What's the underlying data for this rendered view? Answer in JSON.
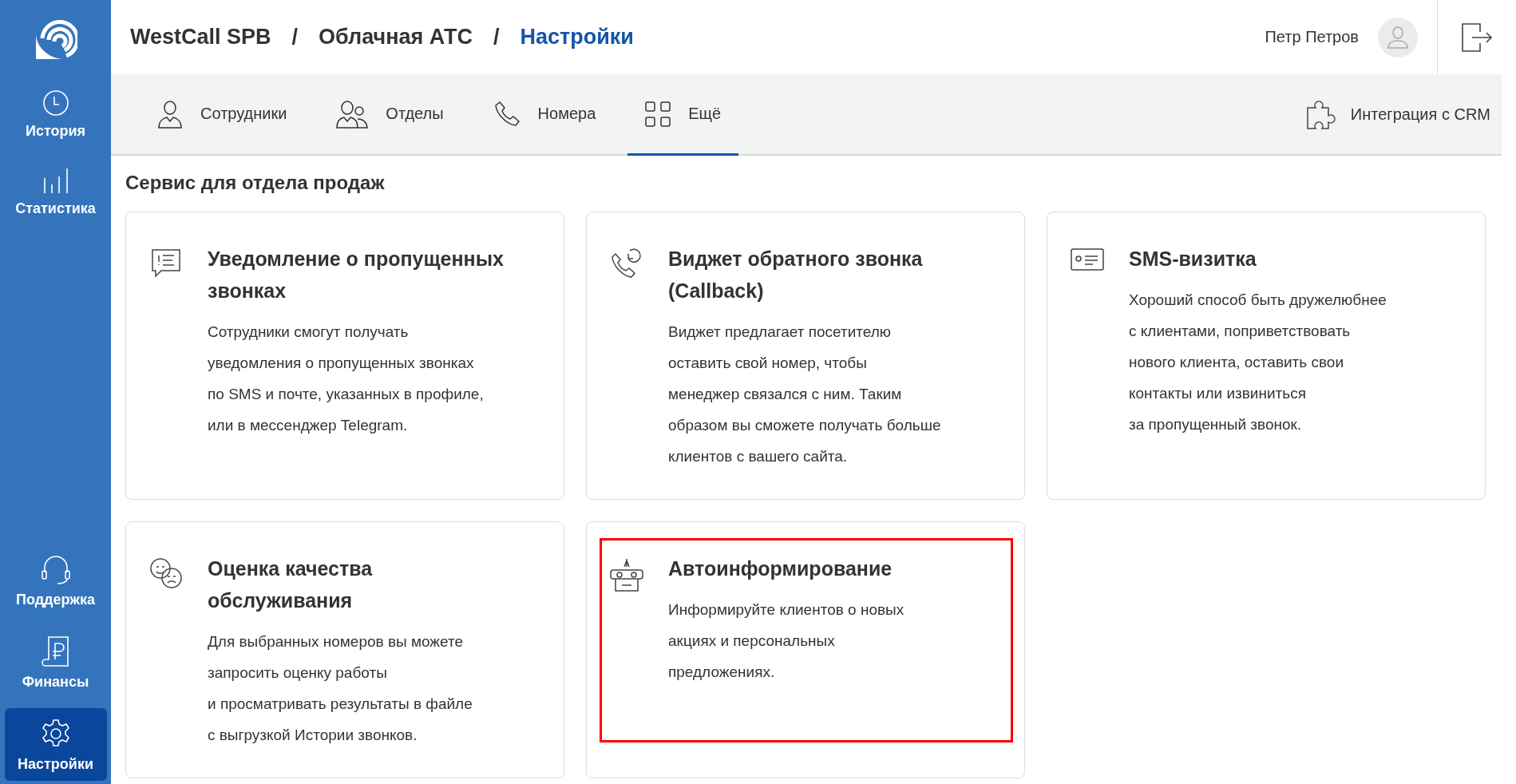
{
  "sidebar": {
    "top_items": [
      {
        "label": "История",
        "kind": "clock",
        "selected": false
      },
      {
        "label": "Статистика",
        "kind": "bars",
        "selected": false
      }
    ],
    "bottom_items": [
      {
        "label": "Поддержка",
        "kind": "headset",
        "selected": false
      },
      {
        "label": "Финансы",
        "kind": "ruble",
        "selected": false
      },
      {
        "label": "Настройки",
        "kind": "gear",
        "selected": true
      }
    ]
  },
  "breadcrumb": [
    {
      "kind": "item",
      "text": "WestCall SPB",
      "current": false
    },
    {
      "kind": "separator",
      "text": "/"
    },
    {
      "kind": "item",
      "text": "Облачная АТС",
      "current": false
    },
    {
      "kind": "separator",
      "text": "/"
    },
    {
      "kind": "item",
      "text": "Настройки",
      "current": true
    }
  ],
  "user": {
    "name": "Петр Петров"
  },
  "tabs": [
    {
      "label": "Сотрудники",
      "kind": "person",
      "selected": false
    },
    {
      "label": "Отделы",
      "kind": "people",
      "selected": false
    },
    {
      "label": "Номера",
      "kind": "phone",
      "selected": false
    },
    {
      "label": "Ещё",
      "kind": "grid",
      "selected": true
    }
  ],
  "crm_link": {
    "label": "Интеграция с CRM"
  },
  "section_title": "Сервис для отдела продаж",
  "cards": [
    {
      "kind": "message",
      "title_lines": [
        "Уведомление о пропущенных",
        "звонках"
      ],
      "description_lines": [
        "Сотрудники смогут получать",
        "уведомления о пропущенных звонках",
        "по SMS и почте, указанных в профиле,",
        "или в мессенджер Telegram."
      ],
      "highlighted": false
    },
    {
      "kind": "callback",
      "title_lines": [
        "Виджет обратного звонка",
        "(Callback)"
      ],
      "description_lines": [
        "Виджет предлагает посетителю",
        "оставить свой номер, чтобы",
        "менеджер связался с ним. Таким",
        "образом вы сможете получать больше",
        "клиентов с вашего сайта."
      ],
      "highlighted": false
    },
    {
      "kind": "card",
      "title_lines": [
        "SMS-визитка"
      ],
      "description_lines": [
        "Хороший способ быть дружелюбнее",
        "с клиентами, поприветствовать",
        "нового клиента, оставить свои",
        "контакты или извиниться",
        "за пропущенный звонок."
      ],
      "highlighted": false
    },
    {
      "kind": "faces",
      "title_lines": [
        "Оценка качества",
        "обслуживания"
      ],
      "description_lines": [
        "Для выбранных номеров вы можете",
        "запросить оценку работы",
        "и просматривать результаты в файле",
        "с выгрузкой Истории звонков."
      ],
      "highlighted": false
    },
    {
      "kind": "robot",
      "title_lines": [
        "Автоинформирование"
      ],
      "description_lines": [
        "Информируйте клиентов о новых",
        "акциях и персональных",
        "предложениях."
      ],
      "highlighted": true
    }
  ]
}
